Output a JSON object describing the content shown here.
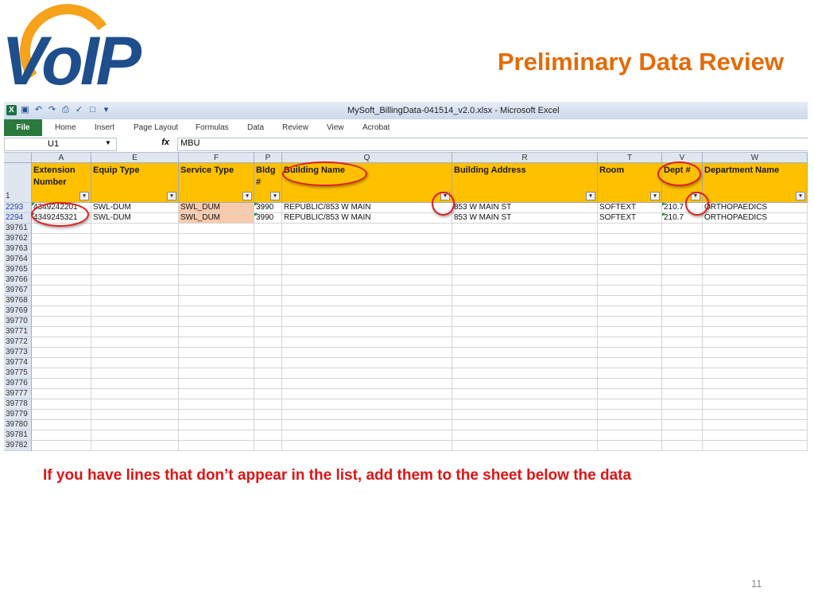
{
  "logo": {
    "text": "VoIP",
    "arc_color": "#f7a21b",
    "text_color": "#1f4e8c"
  },
  "slide": {
    "title": "Preliminary Data Review",
    "title_color": "#e36c0a",
    "caption": "If you have lines that don’t appear in the list, add them to the sheet below the data",
    "caption_color": "#e01414",
    "page_number": "11"
  },
  "excel": {
    "window_title": "MySoft_BillingData-041514_v2.0.xlsx - Microsoft Excel",
    "ribbon_tabs": [
      "File",
      "Home",
      "Insert",
      "Page Layout",
      "Formulas",
      "Data",
      "Review",
      "View",
      "Acrobat"
    ],
    "name_box": "U1",
    "formula_value": "MBU",
    "fx_label": "fx",
    "column_letters": [
      "A",
      "E",
      "F",
      "P",
      "Q",
      "R",
      "T",
      "V",
      "W"
    ],
    "header_row_number": "1",
    "headers": [
      "Extension Number",
      "Equip Type",
      "Service Type",
      "Bldg #",
      "Building Name",
      "Building Address",
      "Room",
      "Dept #",
      "Department Name"
    ],
    "data_rows": [
      {
        "row": "2293",
        "cells": [
          "4349242201",
          "SWL-DUM",
          "SWL_DUM",
          "3990",
          "REPUBLIC/853 W MAIN",
          "853 W MAIN ST",
          "SOFTEXT",
          "210.7",
          "ORTHOPAEDICS"
        ]
      },
      {
        "row": "2294",
        "cells": [
          "4349245321",
          "SWL-DUM",
          "SWL_DUM",
          "3990",
          "REPUBLIC/853 W MAIN",
          "853 W MAIN ST",
          "SOFTEXT",
          "210.7",
          "ORTHOPAEDICS"
        ]
      }
    ],
    "empty_rows": [
      "39761",
      "39762",
      "39763",
      "39764",
      "39765",
      "39766",
      "39767",
      "39768",
      "39769",
      "39770",
      "39771",
      "39772",
      "39773",
      "39774",
      "39775",
      "39776",
      "39777",
      "39778",
      "39779",
      "39780",
      "39781",
      "39782"
    ],
    "header_color": "#ffc000",
    "highlight_color": "#f8cbad",
    "annotation_color": "#e01e1e"
  }
}
